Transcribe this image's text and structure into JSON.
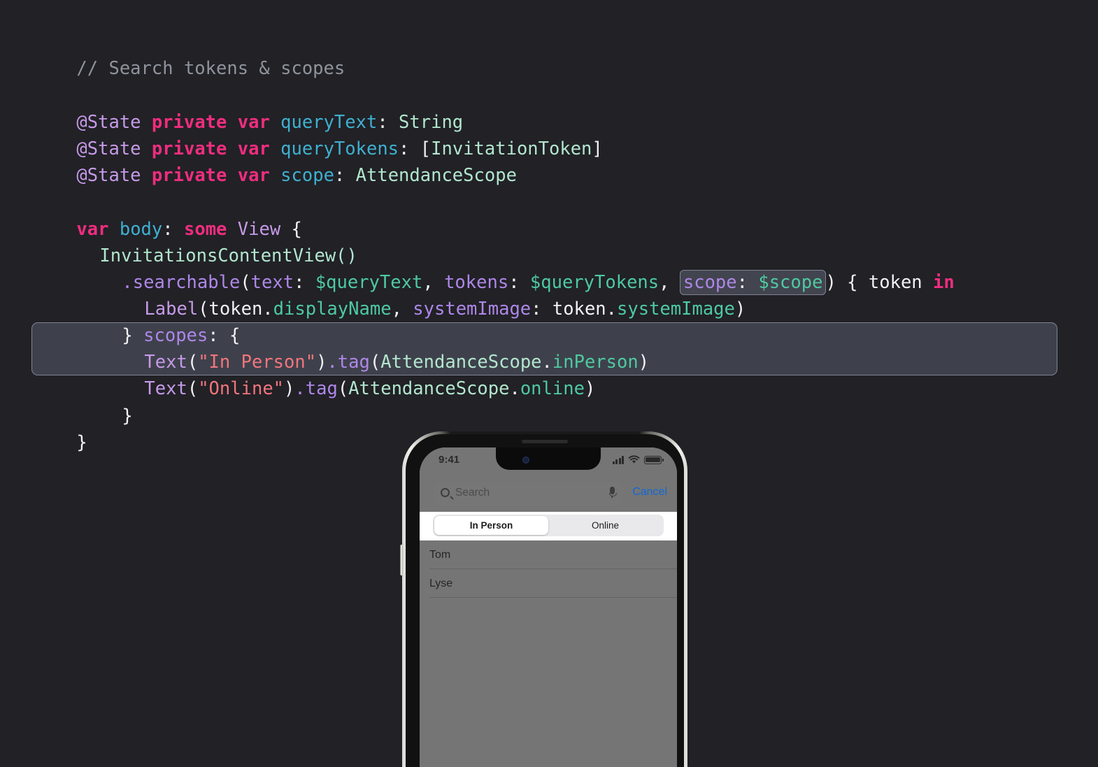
{
  "theme": {
    "background": "#212126",
    "comment_color": "#8f939c",
    "keyword_color": "#ef2d7e",
    "attribute_color": "#c79ae8",
    "variable_color": "#3fb0d0",
    "type_color": "#b2e6cd",
    "method_color": "#ae87e8",
    "property_color": "#4ec9a0",
    "string_color": "#f2757c",
    "plain_color": "#f2f2f4",
    "highlight_background": "#3e414c",
    "highlight_border": "#7f8494",
    "accent_blue": "#1068d6"
  },
  "code": {
    "comment": "// Search tokens & scopes",
    "state1": {
      "attribute": "@State",
      "private": "private",
      "var": "var",
      "name": "queryText",
      "colon": ": ",
      "type": "String"
    },
    "state2": {
      "attribute": "@State",
      "private": "private",
      "var": "var",
      "name": "queryTokens",
      "colon": ": ",
      "open_bracket": "[",
      "type": "InvitationToken",
      "close_bracket": "]"
    },
    "state3": {
      "attribute": "@State",
      "private": "private",
      "var": "var",
      "name": "scope",
      "colon": ": ",
      "type": "AttendanceScope"
    },
    "body_decl": {
      "var": "var",
      "name": "body",
      "colon": ": ",
      "some": "some",
      "view": "View",
      "brace": " {"
    },
    "content_view": "InvitationsContentView()",
    "searchable": {
      "dot_method": ".searchable",
      "paren_open": "(",
      "label_text": "text",
      "colon1": ": ",
      "binding_text": "$queryText",
      "comma1": ", ",
      "label_tokens": "tokens",
      "colon2": ": ",
      "binding_tokens": "$queryTokens",
      "comma2": ", ",
      "hl_label_scope": "scope",
      "hl_colon": ": ",
      "hl_binding_scope": "$scope",
      "paren_close": ")",
      "closure_open": " { ",
      "closure_param": "token",
      "closure_in": " in"
    },
    "label_line": {
      "name": "Label",
      "paren_open": "(",
      "obj1": "token.",
      "prop1": "displayName",
      "comma": ", ",
      "arg_label": "systemImage",
      "colon": ": ",
      "obj2": "token.",
      "prop2": "systemImage",
      "paren_close": ")"
    },
    "scopes_line": {
      "close_brace": "} ",
      "label": "scopes",
      "colon": ": {"
    },
    "text_in_person": {
      "text": "Text",
      "paren_open": "(",
      "string": "\"In Person\"",
      "paren_close": ")",
      "dot_tag": ".tag",
      "tag_paren_open": "(",
      "enum_type": "AttendanceScope",
      "dot": ".",
      "enum_case": "inPerson",
      "tag_paren_close": ")"
    },
    "text_online": {
      "text": "Text",
      "paren_open": "(",
      "string": "\"Online\"",
      "paren_close": ")",
      "dot_tag": ".tag",
      "tag_paren_open": "(",
      "enum_type": "AttendanceScope",
      "dot": ".",
      "enum_case": "online",
      "tag_paren_close": ")"
    },
    "close_inner": "}",
    "close_outer": "}"
  },
  "phone": {
    "status_bar": {
      "time": "9:41",
      "cellular_icon": "signal-bars-icon",
      "wifi_icon": "wifi-icon",
      "battery_icon": "battery-icon"
    },
    "search": {
      "placeholder": "Search",
      "search_icon": "search-icon",
      "mic_icon": "microphone-icon",
      "cancel_label": "Cancel"
    },
    "scopes": {
      "options": [
        "In Person",
        "Online"
      ],
      "selected": "In Person"
    },
    "list": {
      "rows": [
        "Tom",
        "Lyse"
      ]
    }
  }
}
